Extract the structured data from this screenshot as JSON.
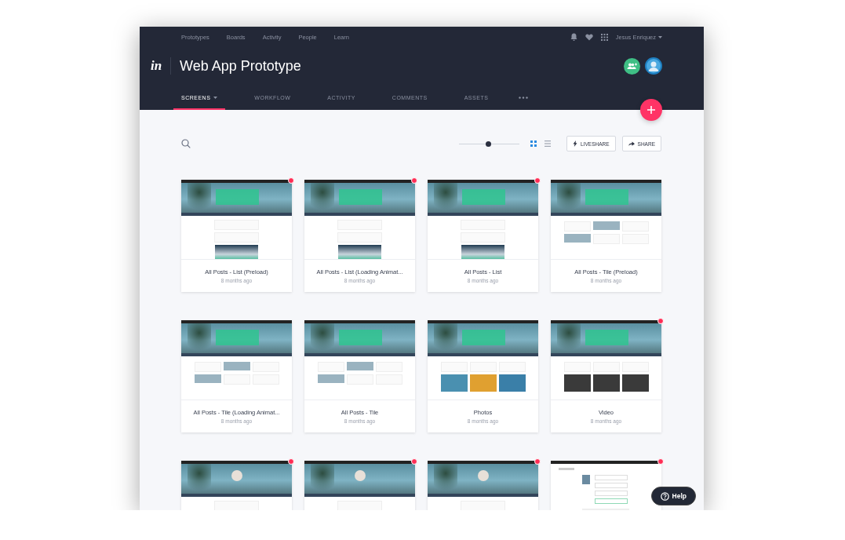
{
  "top_nav": {
    "links": [
      "Prototypes",
      "Boards",
      "Activity",
      "People",
      "Learn"
    ],
    "user": "Jesus Enriquez"
  },
  "project": {
    "logo": "in",
    "title": "Web App Prototype"
  },
  "tabs": [
    {
      "label": "SCREENS",
      "selected": true,
      "dropdown": true
    },
    {
      "label": "WORKFLOW",
      "selected": false,
      "dropdown": false
    },
    {
      "label": "ACTIVITY",
      "selected": false,
      "dropdown": false
    },
    {
      "label": "COMMENTS",
      "selected": false,
      "dropdown": false
    },
    {
      "label": "ASSETS",
      "selected": false,
      "dropdown": false
    }
  ],
  "toolbar": {
    "zoom": {
      "level": 0.48
    },
    "views": [
      {
        "kind": "grid",
        "selected": true
      },
      {
        "kind": "list",
        "selected": false
      }
    ],
    "buttons": [
      {
        "kind": "liveshare",
        "label": "LIVESHARE"
      },
      {
        "kind": "share",
        "label": "SHARE"
      }
    ]
  },
  "screens": [
    {
      "title": "All Posts - List (Preload)",
      "updated": "8 months ago",
      "unread": true,
      "kind": "list"
    },
    {
      "title": "All Posts - List (Loading Animat...",
      "updated": "8 months ago",
      "unread": true,
      "kind": "list"
    },
    {
      "title": "All Posts - List",
      "updated": "8 months ago",
      "unread": true,
      "kind": "list"
    },
    {
      "title": "All Posts - Tile (Preload)",
      "updated": "8 months ago",
      "unread": false,
      "kind": "tile"
    },
    {
      "title": "All Posts - Tile (Loading Animat...",
      "updated": "8 months ago",
      "unread": false,
      "kind": "tile"
    },
    {
      "title": "All Posts - Tile",
      "updated": "8 months ago",
      "unread": false,
      "kind": "tile"
    },
    {
      "title": "Photos",
      "updated": "8 months ago",
      "unread": false,
      "kind": "photos"
    },
    {
      "title": "Video",
      "updated": "8 months ago",
      "unread": true,
      "kind": "video"
    },
    {
      "unread": true,
      "kind": "profile"
    },
    {
      "unread": true,
      "kind": "profile"
    },
    {
      "unread": true,
      "kind": "profile"
    },
    {
      "unread": true,
      "kind": "settings"
    }
  ],
  "help": {
    "label": "Help"
  }
}
